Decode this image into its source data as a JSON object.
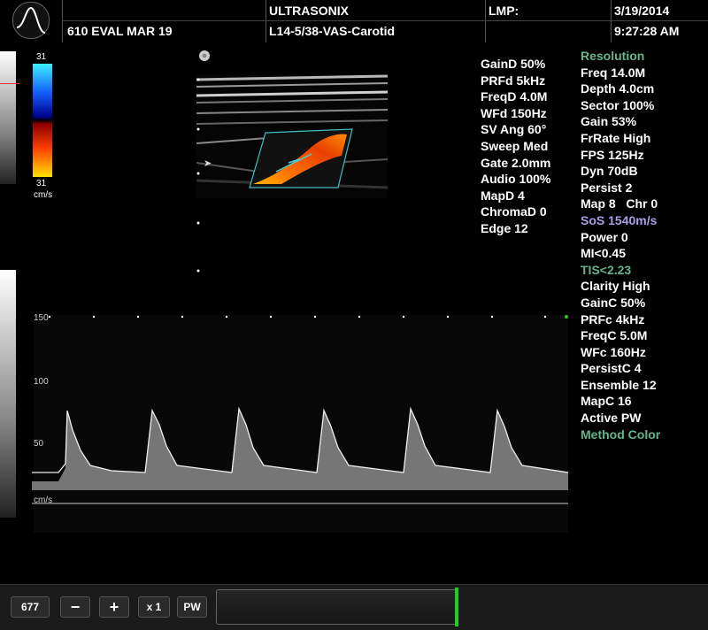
{
  "header": {
    "brand": "ULTRASONIX",
    "lmp_label": "LMP:",
    "date": "3/19/2014",
    "patient": "610 EVAL MAR 19",
    "preset": "L14-5/38-VAS-Carotid",
    "time": "9:27:28 AM"
  },
  "color_scale": {
    "top_value": "31",
    "bottom_value": "31",
    "unit": "cm/s"
  },
  "doppler_params": [
    "GainD 50%",
    "PRFd 5kHz",
    "FreqD 4.0M",
    "WFd 150Hz",
    "SV Ang 60°",
    "Sweep Med",
    "Gate 2.0mm",
    "Audio 100%",
    "MapD 4",
    "ChromaD 0",
    "Edge 12"
  ],
  "imaging_params": [
    {
      "text": "Resolution",
      "color": "green"
    },
    {
      "text": "Freq 14.0M",
      "color": "white"
    },
    {
      "text": "Depth 4.0cm",
      "color": "white"
    },
    {
      "text": "Sector 100%",
      "color": "white"
    },
    {
      "text": "Gain 53%",
      "color": "white"
    },
    {
      "text": "FrRate High",
      "color": "white"
    },
    {
      "text": "FPS 125Hz",
      "color": "white"
    },
    {
      "text": "Dyn 70dB",
      "color": "white"
    },
    {
      "text": "Persist 2",
      "color": "white"
    },
    {
      "text": "Map 8   Chr 0",
      "color": "white"
    },
    {
      "text": "SoS 1540m/s",
      "color": "purple"
    },
    {
      "text": "Power 0",
      "color": "white"
    },
    {
      "text": "MI<0.45",
      "color": "white"
    },
    {
      "text": "TIS<2.23",
      "color": "green"
    },
    {
      "text": "Clarity High",
      "color": "white"
    },
    {
      "text": "GainC 50%",
      "color": "white"
    },
    {
      "text": "PRFc 4kHz",
      "color": "white"
    },
    {
      "text": "FreqC 5.0M",
      "color": "white"
    },
    {
      "text": "WFc 160Hz",
      "color": "white"
    },
    {
      "text": "PersistC 4",
      "color": "white"
    },
    {
      "text": "Ensemble 12",
      "color": "white"
    },
    {
      "text": "MapC 16",
      "color": "white"
    },
    {
      "text": "Active PW",
      "color": "white"
    },
    {
      "text": "Method Color",
      "color": "green"
    }
  ],
  "spectrum": {
    "scale_labels": [
      "150",
      "100",
      "50"
    ],
    "unit": "cm/s"
  },
  "toolbar": {
    "frame_count": "677",
    "minus_label": "−",
    "plus_label": "+",
    "zoom_label": "x 1",
    "mode_label": "PW"
  },
  "colors": {
    "green_text": "#64b48c",
    "purple_text": "#a9a0e8",
    "slider_marker": "#22cc22",
    "roi_box": "#40c0c0"
  }
}
